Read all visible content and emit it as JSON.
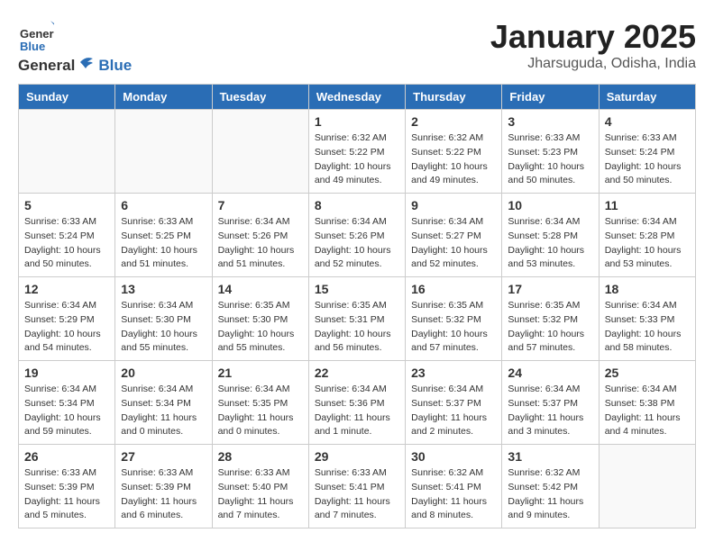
{
  "header": {
    "logo_general": "General",
    "logo_blue": "Blue",
    "month_title": "January 2025",
    "location": "Jharsuguda, Odisha, India"
  },
  "weekdays": [
    "Sunday",
    "Monday",
    "Tuesday",
    "Wednesday",
    "Thursday",
    "Friday",
    "Saturday"
  ],
  "weeks": [
    [
      {
        "day": "",
        "info": ""
      },
      {
        "day": "",
        "info": ""
      },
      {
        "day": "",
        "info": ""
      },
      {
        "day": "1",
        "info": "Sunrise: 6:32 AM\nSunset: 5:22 PM\nDaylight: 10 hours\nand 49 minutes."
      },
      {
        "day": "2",
        "info": "Sunrise: 6:32 AM\nSunset: 5:22 PM\nDaylight: 10 hours\nand 49 minutes."
      },
      {
        "day": "3",
        "info": "Sunrise: 6:33 AM\nSunset: 5:23 PM\nDaylight: 10 hours\nand 50 minutes."
      },
      {
        "day": "4",
        "info": "Sunrise: 6:33 AM\nSunset: 5:24 PM\nDaylight: 10 hours\nand 50 minutes."
      }
    ],
    [
      {
        "day": "5",
        "info": "Sunrise: 6:33 AM\nSunset: 5:24 PM\nDaylight: 10 hours\nand 50 minutes."
      },
      {
        "day": "6",
        "info": "Sunrise: 6:33 AM\nSunset: 5:25 PM\nDaylight: 10 hours\nand 51 minutes."
      },
      {
        "day": "7",
        "info": "Sunrise: 6:34 AM\nSunset: 5:26 PM\nDaylight: 10 hours\nand 51 minutes."
      },
      {
        "day": "8",
        "info": "Sunrise: 6:34 AM\nSunset: 5:26 PM\nDaylight: 10 hours\nand 52 minutes."
      },
      {
        "day": "9",
        "info": "Sunrise: 6:34 AM\nSunset: 5:27 PM\nDaylight: 10 hours\nand 52 minutes."
      },
      {
        "day": "10",
        "info": "Sunrise: 6:34 AM\nSunset: 5:28 PM\nDaylight: 10 hours\nand 53 minutes."
      },
      {
        "day": "11",
        "info": "Sunrise: 6:34 AM\nSunset: 5:28 PM\nDaylight: 10 hours\nand 53 minutes."
      }
    ],
    [
      {
        "day": "12",
        "info": "Sunrise: 6:34 AM\nSunset: 5:29 PM\nDaylight: 10 hours\nand 54 minutes."
      },
      {
        "day": "13",
        "info": "Sunrise: 6:34 AM\nSunset: 5:30 PM\nDaylight: 10 hours\nand 55 minutes."
      },
      {
        "day": "14",
        "info": "Sunrise: 6:35 AM\nSunset: 5:30 PM\nDaylight: 10 hours\nand 55 minutes."
      },
      {
        "day": "15",
        "info": "Sunrise: 6:35 AM\nSunset: 5:31 PM\nDaylight: 10 hours\nand 56 minutes."
      },
      {
        "day": "16",
        "info": "Sunrise: 6:35 AM\nSunset: 5:32 PM\nDaylight: 10 hours\nand 57 minutes."
      },
      {
        "day": "17",
        "info": "Sunrise: 6:35 AM\nSunset: 5:32 PM\nDaylight: 10 hours\nand 57 minutes."
      },
      {
        "day": "18",
        "info": "Sunrise: 6:34 AM\nSunset: 5:33 PM\nDaylight: 10 hours\nand 58 minutes."
      }
    ],
    [
      {
        "day": "19",
        "info": "Sunrise: 6:34 AM\nSunset: 5:34 PM\nDaylight: 10 hours\nand 59 minutes."
      },
      {
        "day": "20",
        "info": "Sunrise: 6:34 AM\nSunset: 5:34 PM\nDaylight: 11 hours\nand 0 minutes."
      },
      {
        "day": "21",
        "info": "Sunrise: 6:34 AM\nSunset: 5:35 PM\nDaylight: 11 hours\nand 0 minutes."
      },
      {
        "day": "22",
        "info": "Sunrise: 6:34 AM\nSunset: 5:36 PM\nDaylight: 11 hours\nand 1 minute."
      },
      {
        "day": "23",
        "info": "Sunrise: 6:34 AM\nSunset: 5:37 PM\nDaylight: 11 hours\nand 2 minutes."
      },
      {
        "day": "24",
        "info": "Sunrise: 6:34 AM\nSunset: 5:37 PM\nDaylight: 11 hours\nand 3 minutes."
      },
      {
        "day": "25",
        "info": "Sunrise: 6:34 AM\nSunset: 5:38 PM\nDaylight: 11 hours\nand 4 minutes."
      }
    ],
    [
      {
        "day": "26",
        "info": "Sunrise: 6:33 AM\nSunset: 5:39 PM\nDaylight: 11 hours\nand 5 minutes."
      },
      {
        "day": "27",
        "info": "Sunrise: 6:33 AM\nSunset: 5:39 PM\nDaylight: 11 hours\nand 6 minutes."
      },
      {
        "day": "28",
        "info": "Sunrise: 6:33 AM\nSunset: 5:40 PM\nDaylight: 11 hours\nand 7 minutes."
      },
      {
        "day": "29",
        "info": "Sunrise: 6:33 AM\nSunset: 5:41 PM\nDaylight: 11 hours\nand 7 minutes."
      },
      {
        "day": "30",
        "info": "Sunrise: 6:32 AM\nSunset: 5:41 PM\nDaylight: 11 hours\nand 8 minutes."
      },
      {
        "day": "31",
        "info": "Sunrise: 6:32 AM\nSunset: 5:42 PM\nDaylight: 11 hours\nand 9 minutes."
      },
      {
        "day": "",
        "info": ""
      }
    ]
  ]
}
